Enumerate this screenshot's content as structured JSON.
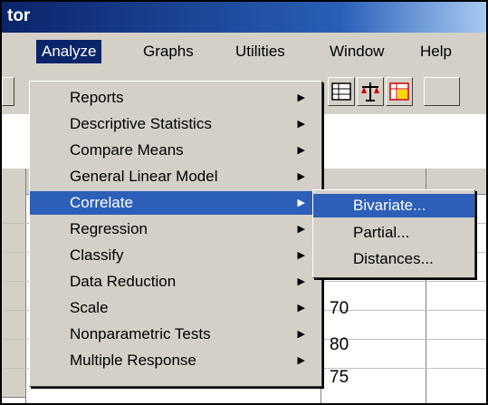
{
  "window": {
    "title_fragment": "tor"
  },
  "menubar": [
    "Analyze",
    "Graphs",
    "Utilities",
    "Window",
    "Help"
  ],
  "analyze_menu": {
    "items": [
      {
        "label": "Reports",
        "submenu": true
      },
      {
        "label": "Descriptive Statistics",
        "submenu": true
      },
      {
        "label": "Compare Means",
        "submenu": true
      },
      {
        "label": "General Linear Model",
        "submenu": true
      },
      {
        "label": "Correlate",
        "submenu": true
      },
      {
        "label": "Regression",
        "submenu": true
      },
      {
        "label": "Classify",
        "submenu": true
      },
      {
        "label": "Data Reduction",
        "submenu": true
      },
      {
        "label": "Scale",
        "submenu": true
      },
      {
        "label": "Nonparametric Tests",
        "submenu": true
      },
      {
        "label": "Multiple Response",
        "submenu": true
      }
    ],
    "highlighted": "Correlate"
  },
  "correlate_submenu": {
    "items": [
      "Bivariate...",
      "Partial...",
      "Distances..."
    ],
    "highlighted": "Bivariate..."
  },
  "grid": {
    "visible_values": [
      "70",
      "80",
      "75"
    ]
  },
  "icons": [
    "table-icon",
    "scale-icon",
    "select-cases-icon"
  ],
  "colors": {
    "titlebar": "#0a246a",
    "highlight": "#2d5fb8",
    "face": "#d4d0c8"
  }
}
